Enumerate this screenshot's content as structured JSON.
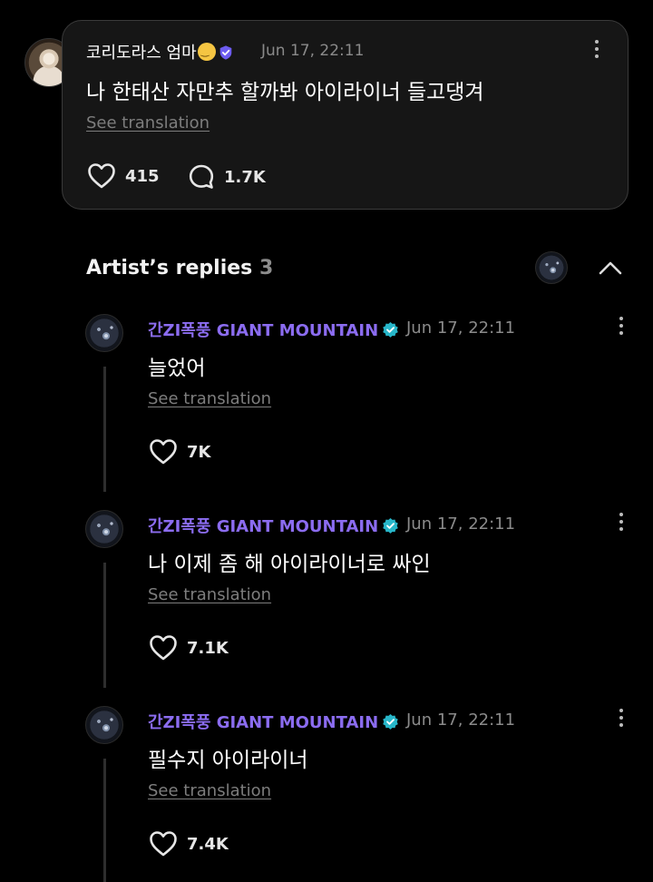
{
  "parent_comment": {
    "author": "코리도라스 엄마",
    "timestamp": "Jun 17, 22:11",
    "text": "나 한태산 자만추 할까봐 아이라이너 들고댕겨",
    "see_translation": "See translation",
    "likes": "415",
    "replies": "1.7K"
  },
  "artist_replies": {
    "title": "Artist’s replies",
    "count": "3"
  },
  "replies": [
    {
      "author": "간ZI폭풍 GIANT MOUNTAIN",
      "timestamp": "Jun 17, 22:11",
      "text": "늘었어",
      "see_translation": "See translation",
      "likes": "7K"
    },
    {
      "author": "간ZI폭풍 GIANT MOUNTAIN",
      "timestamp": "Jun 17, 22:11",
      "text": "나 이제 좀 해 아이라이너로 싸인",
      "see_translation": "See translation",
      "likes": "7.1K"
    },
    {
      "author": "간ZI폭풍 GIANT MOUNTAIN",
      "timestamp": "Jun 17, 22:11",
      "text": "필수지 아이라이너",
      "see_translation": "See translation",
      "likes": "7.4K"
    }
  ],
  "colors": {
    "background": "#000000",
    "card": "#161616",
    "artist_name": "#8b6cf0",
    "verified_badge": "#27b6c9",
    "muted": "#8a8a8a"
  },
  "icons": [
    "more-icon",
    "heart-icon",
    "comment-icon",
    "chevron-up-icon",
    "verified-badge-icon",
    "shield-badge-icon",
    "emoji-icon"
  ]
}
